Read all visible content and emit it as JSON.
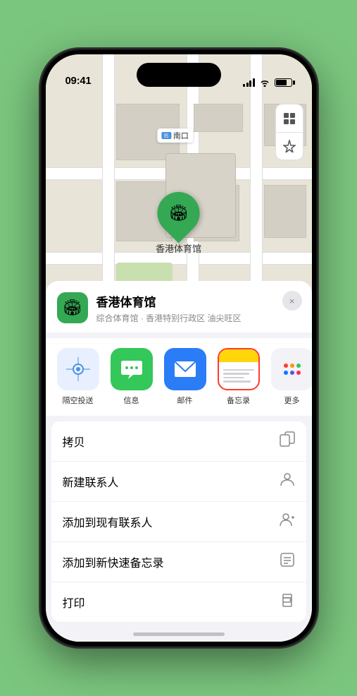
{
  "phone": {
    "time": "09:41",
    "status_icons": {
      "signal": "signal-icon",
      "wifi": "wifi-icon",
      "battery": "battery-icon"
    }
  },
  "map": {
    "location_label": "南口",
    "pin_label": "香港体育馆",
    "controls": {
      "map_type": "🗺",
      "location": "↑"
    }
  },
  "place_info": {
    "name": "香港体育馆",
    "address": "综合体育馆 · 香港特别行政区 油尖旺区",
    "logo_emoji": "🏟",
    "close_label": "×"
  },
  "share_actions": [
    {
      "label": "隔空投送",
      "type": "airdrop"
    },
    {
      "label": "信息",
      "type": "messages"
    },
    {
      "label": "邮件",
      "type": "mail"
    },
    {
      "label": "备忘录",
      "type": "notes"
    },
    {
      "label": "更多",
      "type": "more"
    }
  ],
  "action_list": [
    {
      "label": "拷贝",
      "icon": "copy"
    },
    {
      "label": "新建联系人",
      "icon": "person"
    },
    {
      "label": "添加到现有联系人",
      "icon": "person-add"
    },
    {
      "label": "添加到新快速备忘录",
      "icon": "note"
    },
    {
      "label": "打印",
      "icon": "print"
    }
  ]
}
